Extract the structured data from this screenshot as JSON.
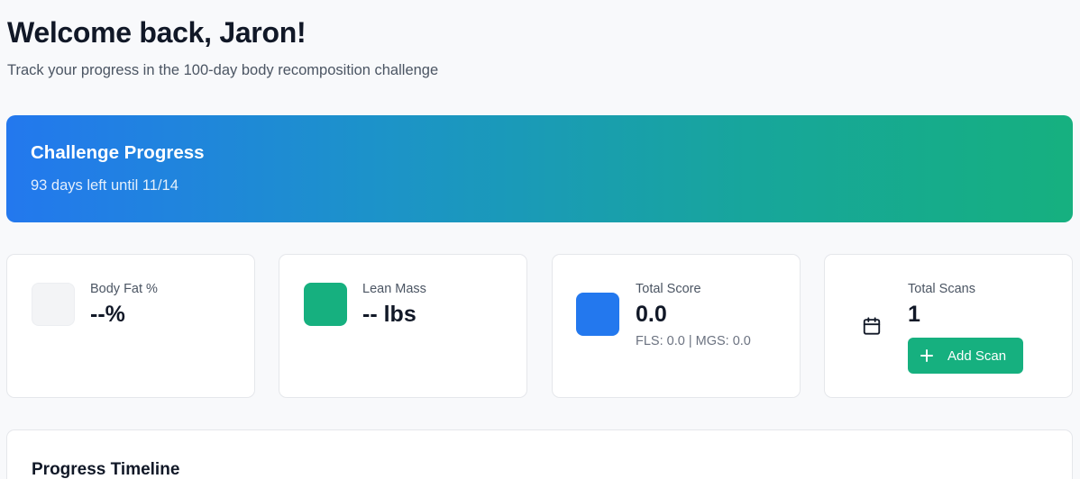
{
  "header": {
    "title": "Welcome back, Jaron!",
    "subtitle": "Track your progress in the 100-day body recomposition challenge"
  },
  "challenge": {
    "title": "Challenge Progress",
    "days_left_text": "93 days left until 11/14"
  },
  "stats": [
    {
      "label": "Body Fat %",
      "value": "--%",
      "icon": "body-fat-icon",
      "icon_color": "#f3f4f6"
    },
    {
      "label": "Lean Mass",
      "value": "-- lbs",
      "icon": "lean-mass-icon",
      "icon_color": "#16b07f"
    },
    {
      "label": "Total Score",
      "value": "0.0",
      "detail": "FLS: 0.0 | MGS: 0.0",
      "icon": "score-icon",
      "icon_color": "#2378ee"
    },
    {
      "label": "Total Scans",
      "value": "1",
      "icon": "calendar-icon",
      "button_label": "Add Scan"
    }
  ],
  "timeline": {
    "title": "Progress Timeline"
  },
  "colors": {
    "gradient_start": "#2378ee",
    "gradient_end": "#16b07f",
    "accent_green": "#16b07f",
    "accent_blue": "#2378ee"
  }
}
